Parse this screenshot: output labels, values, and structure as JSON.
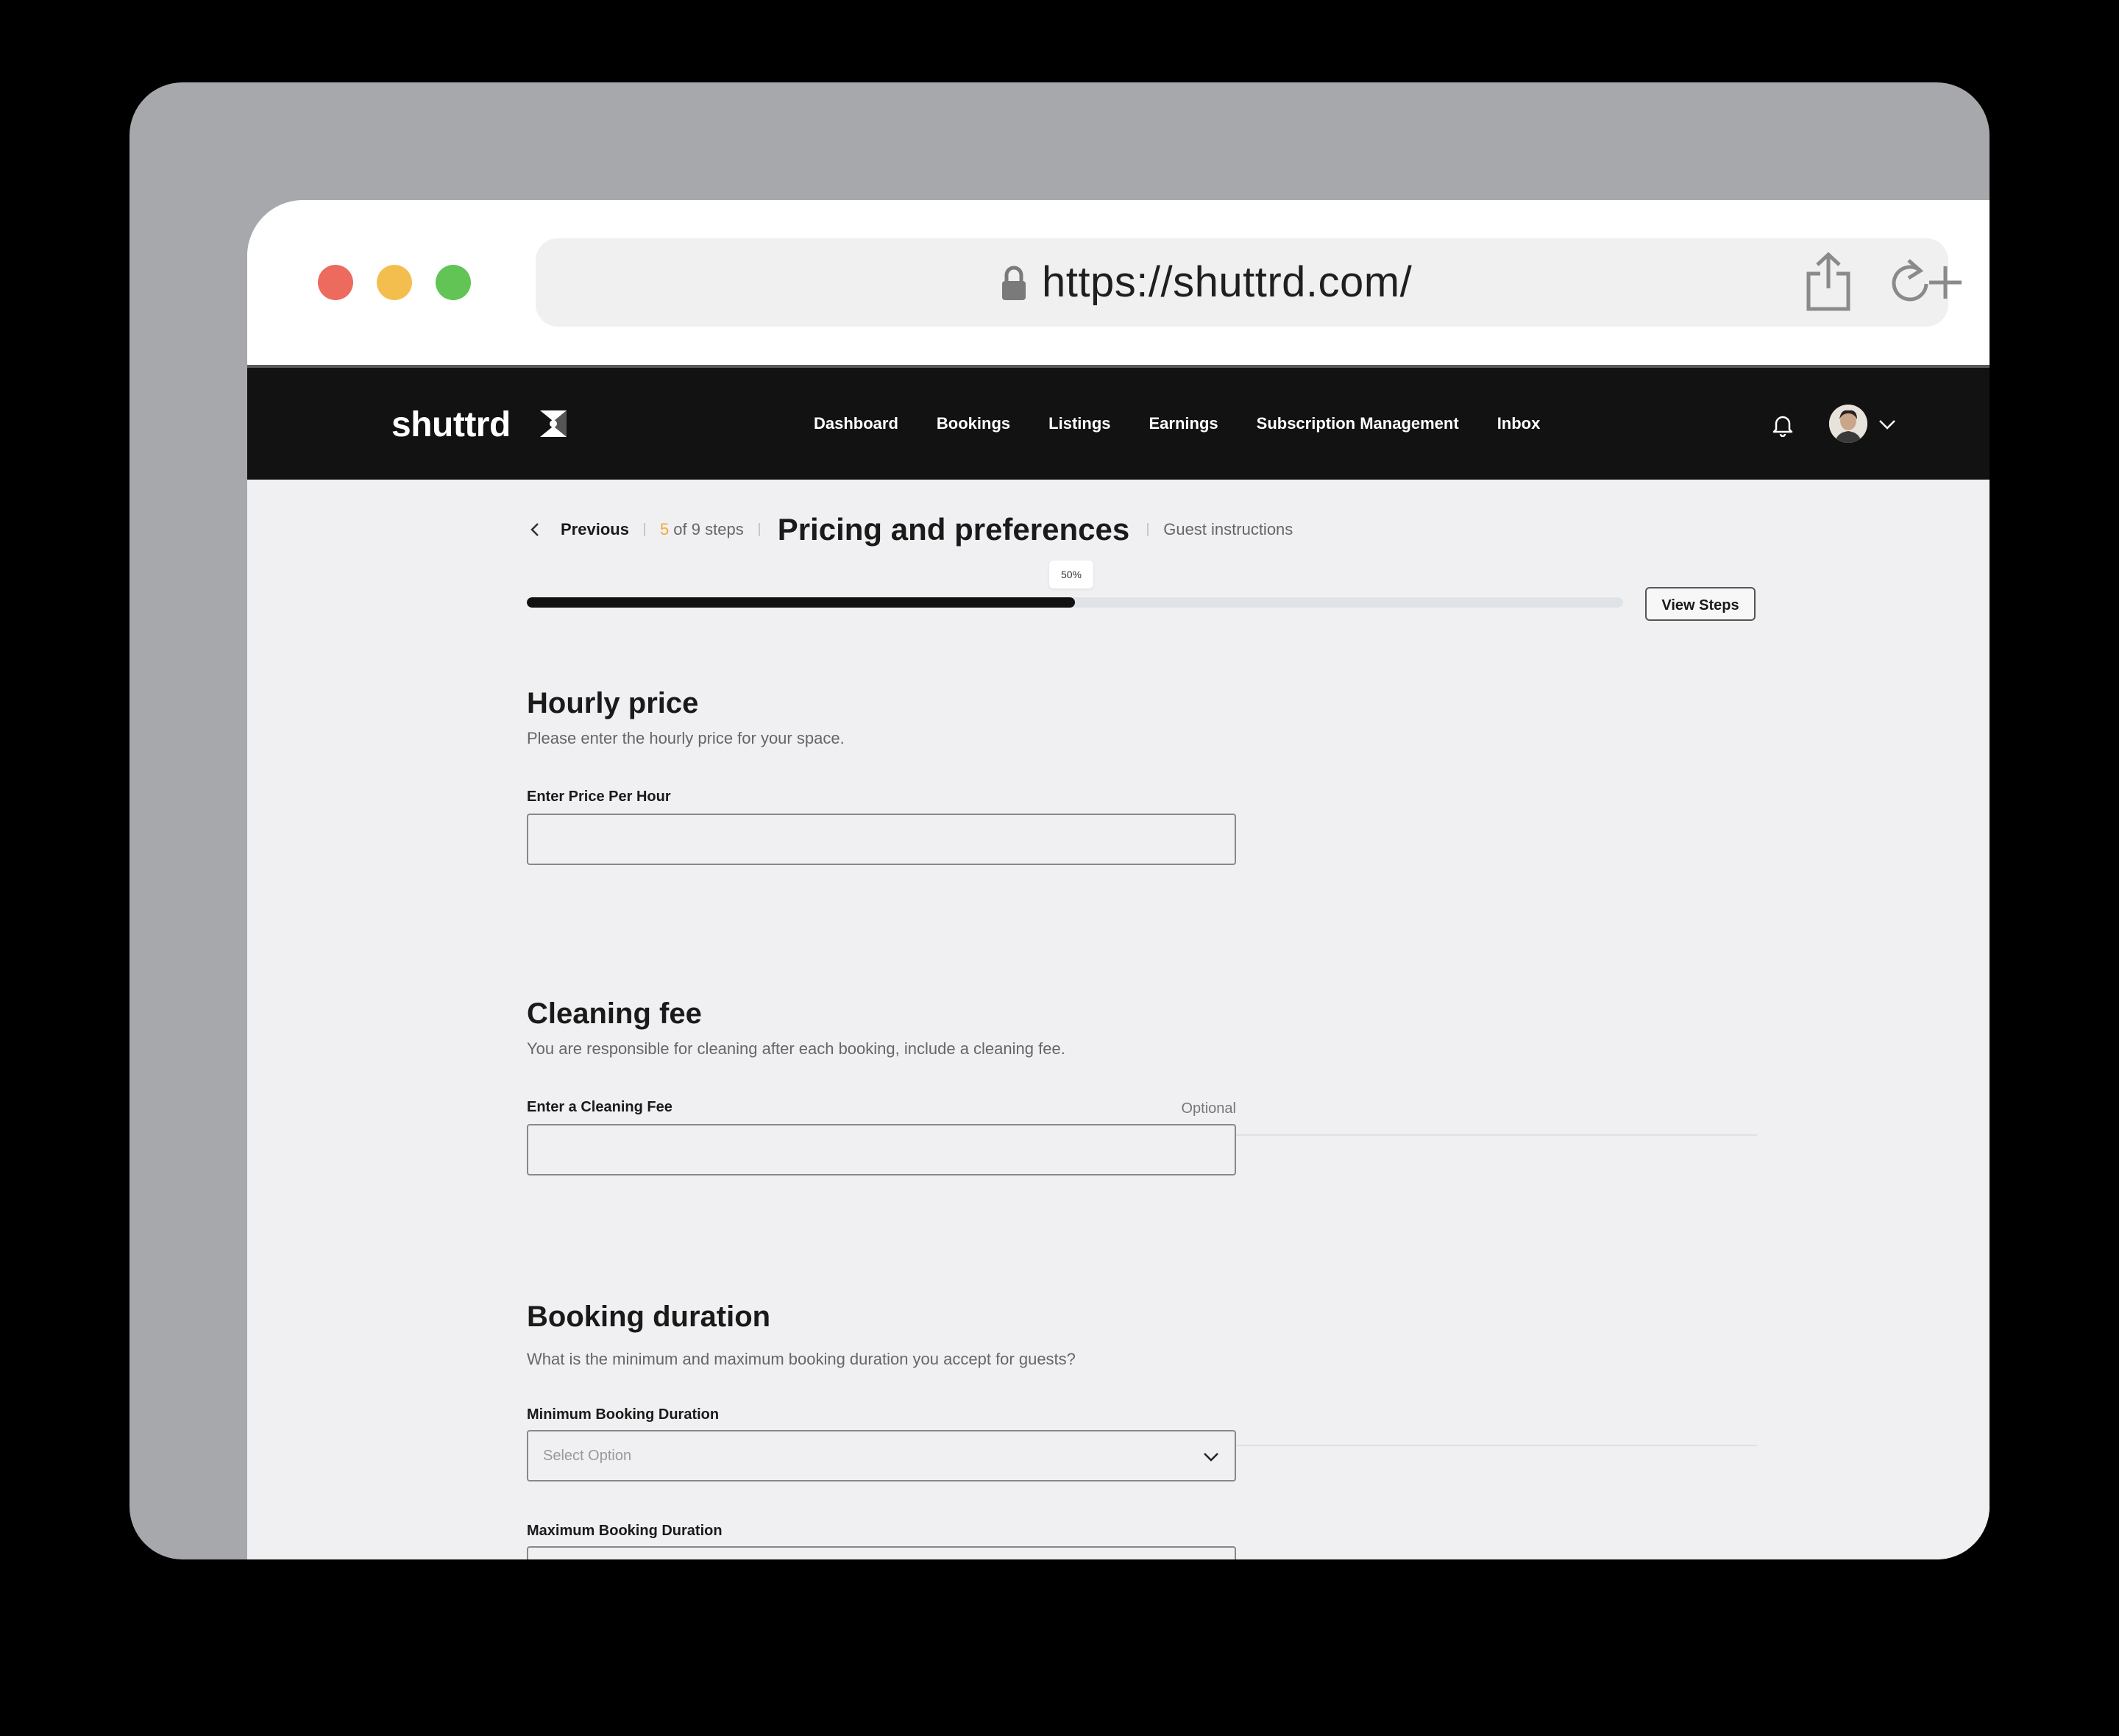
{
  "browser": {
    "url": "https://shuttrd.com/"
  },
  "nav": {
    "brand": "shuttrd",
    "links": [
      "Dashboard",
      "Bookings",
      "Listings",
      "Earnings",
      "Subscription Management",
      "Inbox"
    ]
  },
  "stepper": {
    "previous_label": "Previous",
    "current_step": "5",
    "of_steps": " of 9 steps",
    "current_title": "Pricing and preferences",
    "next_title": "Guest instructions",
    "progress": 0.5,
    "progress_label": "50%",
    "view_steps_label": "View Steps"
  },
  "hourly": {
    "title": "Hourly price",
    "desc": "Please enter the hourly price for your space.",
    "label": "Enter Price Per Hour",
    "value": ""
  },
  "cleaning": {
    "title": "Cleaning fee",
    "desc": "You are responsible for cleaning after each booking, include a cleaning fee.",
    "label": "Enter a Cleaning Fee",
    "optional": "Optional",
    "value": ""
  },
  "duration": {
    "title": "Booking duration",
    "desc": "What is the minimum and maximum booking duration you accept for guests?",
    "min_label": "Minimum Booking Duration",
    "min_placeholder": "Select Option",
    "max_label": "Maximum Booking Duration"
  }
}
